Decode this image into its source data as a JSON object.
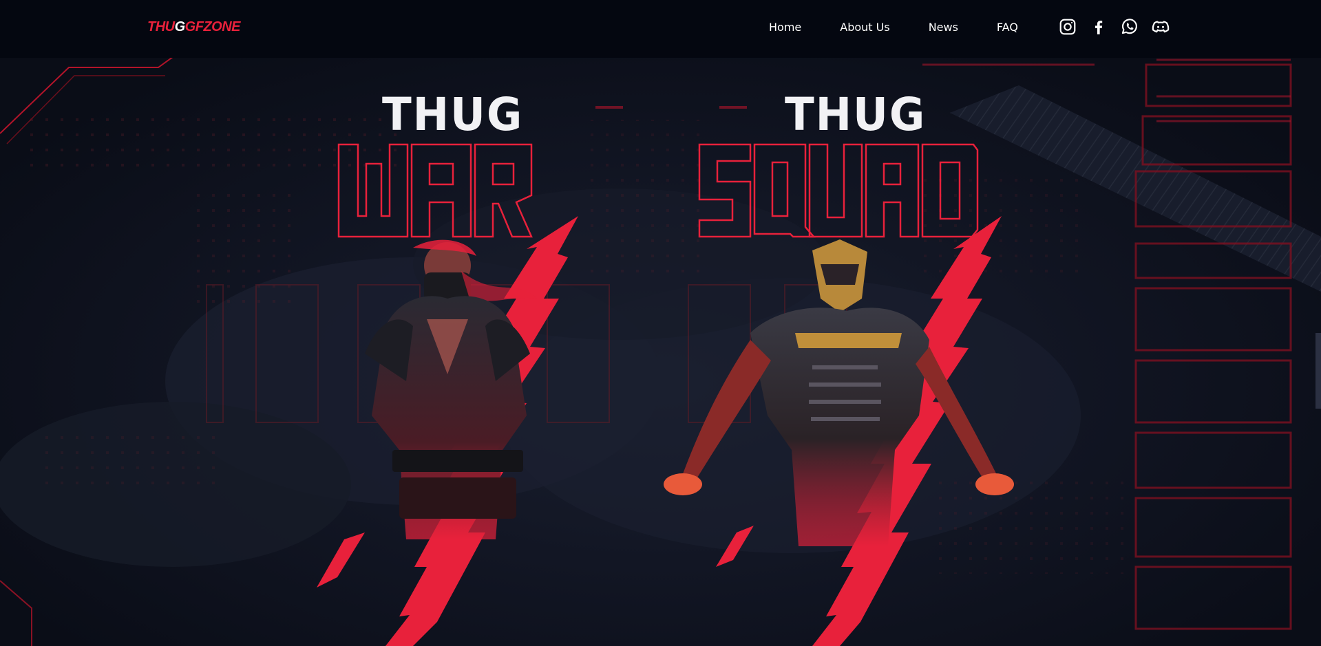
{
  "brand": {
    "logo_part1": "THU",
    "logo_part2": "G",
    "logo_part3": "GFZ",
    "logo_part4": "ONE"
  },
  "nav": {
    "items": [
      {
        "label": "Home"
      },
      {
        "label": "About Us"
      },
      {
        "label": "News"
      },
      {
        "label": "FAQ"
      }
    ]
  },
  "socials": [
    {
      "icon": "instagram-icon"
    },
    {
      "icon": "facebook-icon"
    },
    {
      "icon": "whatsapp-icon"
    },
    {
      "icon": "discord-icon"
    }
  ],
  "cards": [
    {
      "top_text": "THUG",
      "bottom_text": "WAR"
    },
    {
      "top_text": "THUG",
      "bottom_text": "SQUAD"
    }
  ],
  "colors": {
    "accent": "#e8213b",
    "nav_bg": "#040710",
    "hero_bg": "#121624"
  }
}
